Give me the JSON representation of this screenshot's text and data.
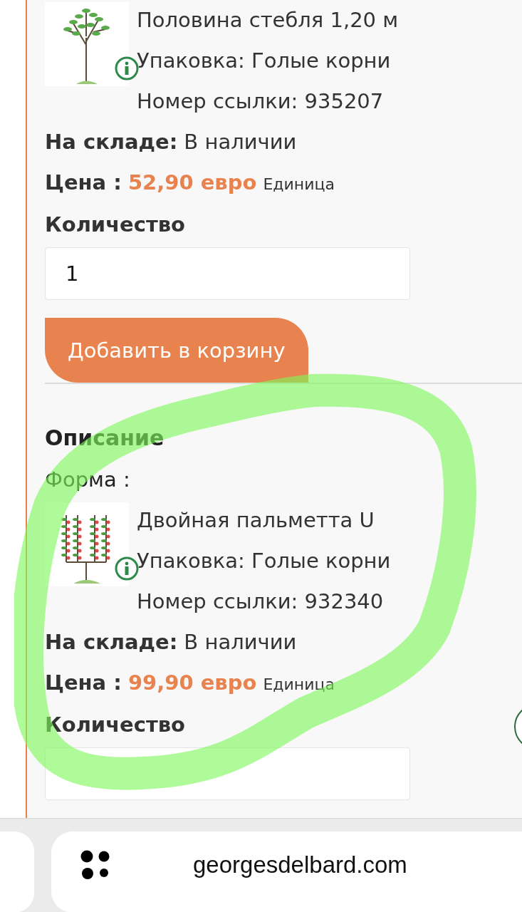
{
  "products": [
    {
      "image": {
        "kind": "tree"
      },
      "variant": "Половина стебля 1,20 м",
      "packaging": "Упаковка: Голые корни",
      "reference": "Номер ссылки: 935207",
      "stock_label": "На складе:",
      "stock_value": "В наличии",
      "price_label": "Цена :",
      "price": "52,90 евро",
      "unit": "Единица",
      "quantity_label": "Количество",
      "quantity_value": "1",
      "add_button": "Добавить в корзину"
    },
    {
      "section_heading": "Описание",
      "form_label": "Форма :",
      "image": {
        "kind": "espalier"
      },
      "variant": "Двойная пальметта U",
      "packaging": "Упаковка: Голые корни",
      "reference": "Номер ссылки: 932340",
      "stock_label": "На складе:",
      "stock_value": "В наличии",
      "price_label": "Цена :",
      "price": "99,90 евро",
      "unit": "Единица",
      "quantity_label": "Количество"
    }
  ],
  "address_bar": {
    "domain": "georgesdelbard.com"
  }
}
